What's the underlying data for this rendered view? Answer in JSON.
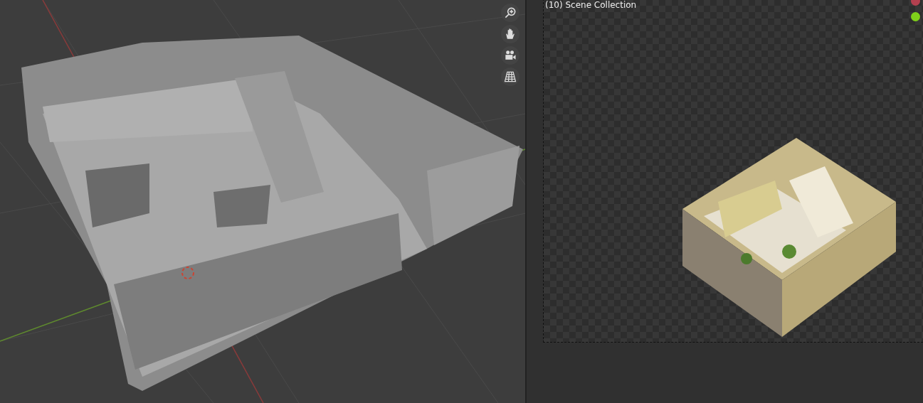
{
  "render_viewport": {
    "collection_label": "(10) Scene Collection"
  }
}
